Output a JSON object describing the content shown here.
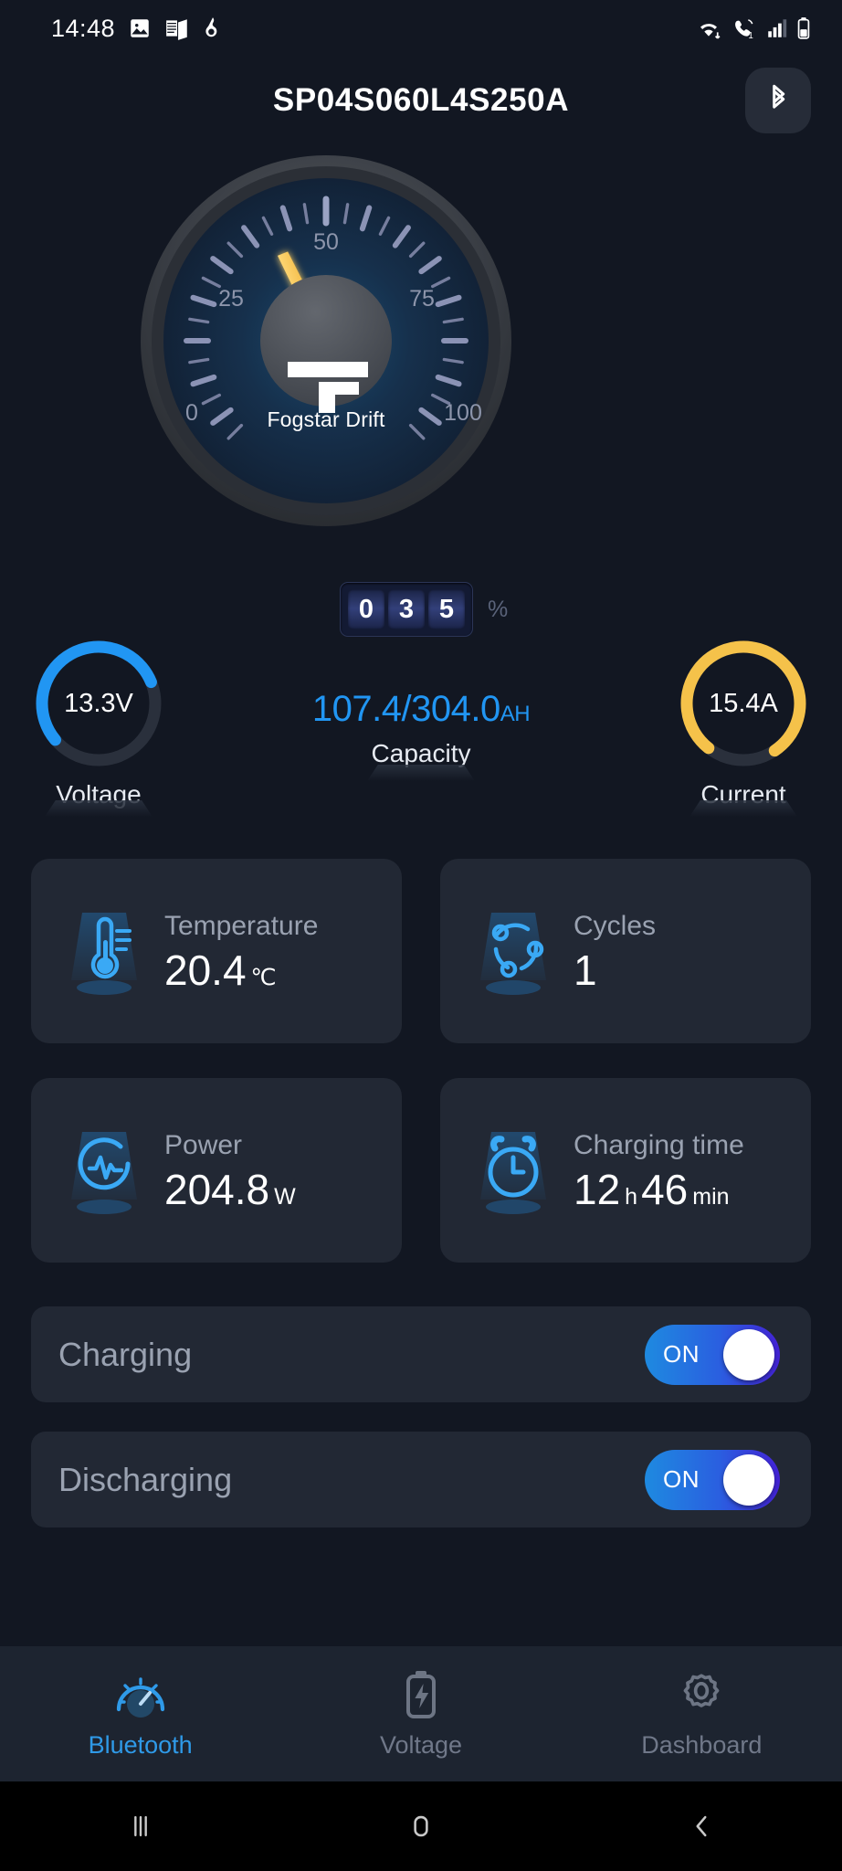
{
  "status_bar": {
    "time": "14:48",
    "left_icons": [
      "image-icon",
      "news-icon",
      "app-icon"
    ],
    "right_icons": [
      "wifi-icon",
      "call-icon",
      "signal-icon",
      "battery-icon"
    ]
  },
  "header": {
    "title": "SP04S060L4S250A",
    "bluetooth_icon": "bluetooth-icon"
  },
  "gauge": {
    "brand_name": "Fogstar Drift",
    "min": 0,
    "max": 100,
    "value": 35,
    "tick_labels": [
      "0",
      "25",
      "50",
      "75",
      "100"
    ],
    "needle_color": "#f5c24a",
    "digits": [
      "0",
      "3",
      "5"
    ],
    "percent_symbol": "%"
  },
  "meters": {
    "voltage": {
      "value": "13.3V",
      "label": "Voltage",
      "color": "#2196f3",
      "pct": 55
    },
    "capacity": {
      "value": "107.4/304.0",
      "unit": "AH",
      "label": "Capacity",
      "color": "#2196f3"
    },
    "current": {
      "value": "15.4A",
      "label": "Current",
      "color": "#f5c24a",
      "pct": 80
    }
  },
  "cards": [
    {
      "label": "Temperature",
      "value": "20.4",
      "unit": "℃",
      "icon": "thermometer-icon"
    },
    {
      "label": "Cycles",
      "value": "1",
      "unit": "",
      "icon": "cycles-icon"
    },
    {
      "label": "Power",
      "value": "204.8",
      "unit": "W",
      "icon": "power-waveform-icon"
    },
    {
      "label": "Charging time",
      "value": "12",
      "unit": "h",
      "value2": "46",
      "unit2": "min",
      "icon": "alarm-clock-icon"
    }
  ],
  "toggles": [
    {
      "label": "Charging",
      "state": "ON",
      "on": true
    },
    {
      "label": "Discharging",
      "state": "ON",
      "on": true
    }
  ],
  "bottom_nav": [
    {
      "label": "Bluetooth",
      "icon": "speedometer-icon",
      "active": true
    },
    {
      "label": "Voltage",
      "icon": "battery-bolt-icon",
      "active": false
    },
    {
      "label": "Dashboard",
      "icon": "gear-icon",
      "active": false
    }
  ],
  "system_nav": [
    {
      "name": "recents-button",
      "icon": "recents-icon"
    },
    {
      "name": "home-button",
      "icon": "home-icon"
    },
    {
      "name": "back-button",
      "icon": "back-icon"
    }
  ],
  "colors": {
    "accent_blue": "#2196f3",
    "accent_amber": "#f5c24a",
    "bg": "#121722",
    "card_bg": "#222834"
  }
}
